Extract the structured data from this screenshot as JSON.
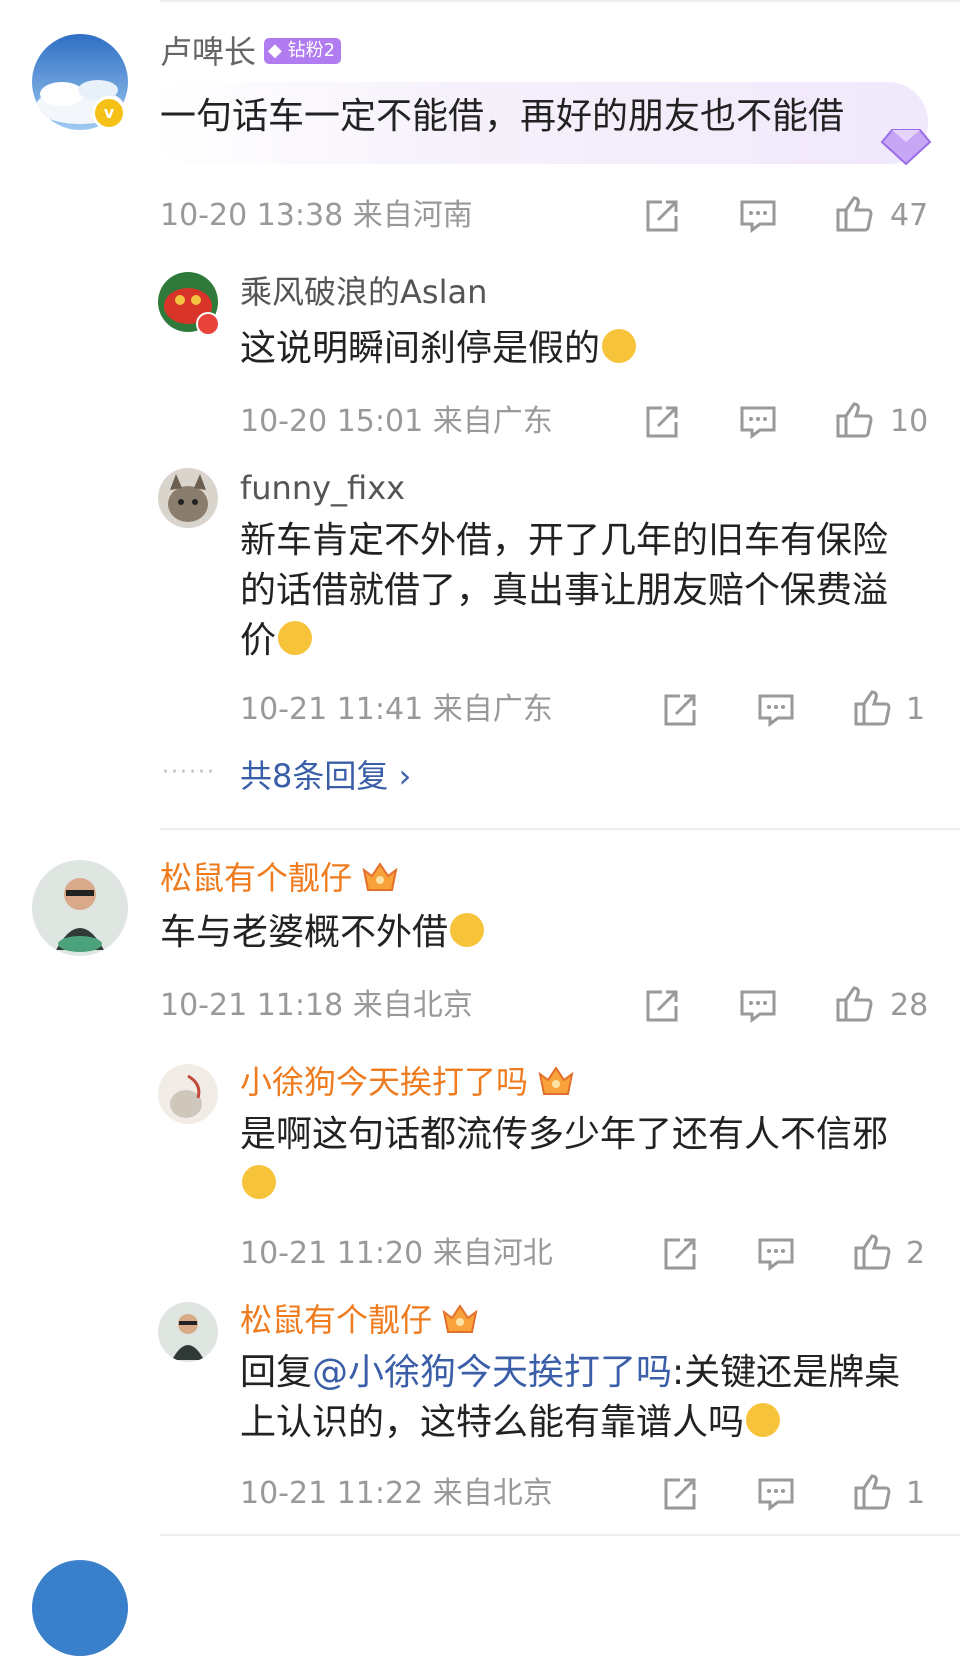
{
  "comments": [
    {
      "username": "卢啤长",
      "fan_badge": "钻粉2",
      "text": "一句话车一定不能借，再好的朋友也不能借",
      "time_location": "10-20 13:38 来自河南",
      "likes": "47",
      "replies": [
        {
          "username": "乘风破浪的Aslan",
          "text": "这说明瞬间刹停是假的",
          "time_location": "10-20 15:01 来自广东",
          "likes": "10"
        },
        {
          "username": "funny_fixx",
          "text": "新车肯定不外借，开了几年的旧车有保险的话借就借了，真出事让朋友赔个保费溢价",
          "time_location": "10-21 11:41 来自广东",
          "likes": "1"
        }
      ],
      "more_replies": "共8条回复 ›"
    },
    {
      "username": "松鼠有个靓仔",
      "text": "车与老婆概不外借",
      "time_location": "10-21 11:18 来自北京",
      "likes": "28",
      "replies": [
        {
          "username": "小徐狗今天挨打了吗",
          "text": "是啊这句话都流传多少年了还有人不信邪",
          "time_location": "10-21 11:20 来自河北",
          "likes": "2"
        },
        {
          "username": "松鼠有个靓仔",
          "reply_prefix": "回复",
          "reply_mention": "@小徐狗今天挨打了吗",
          "text": ":关键还是牌桌上认识的，这特么能有靠谱人吗",
          "time_location": "10-21 11:22 来自北京",
          "likes": "1"
        }
      ]
    }
  ],
  "colors": {
    "accent_link": "#3a5ea8",
    "username_orange": "#ef7b1f",
    "meta_gray": "#999999"
  }
}
